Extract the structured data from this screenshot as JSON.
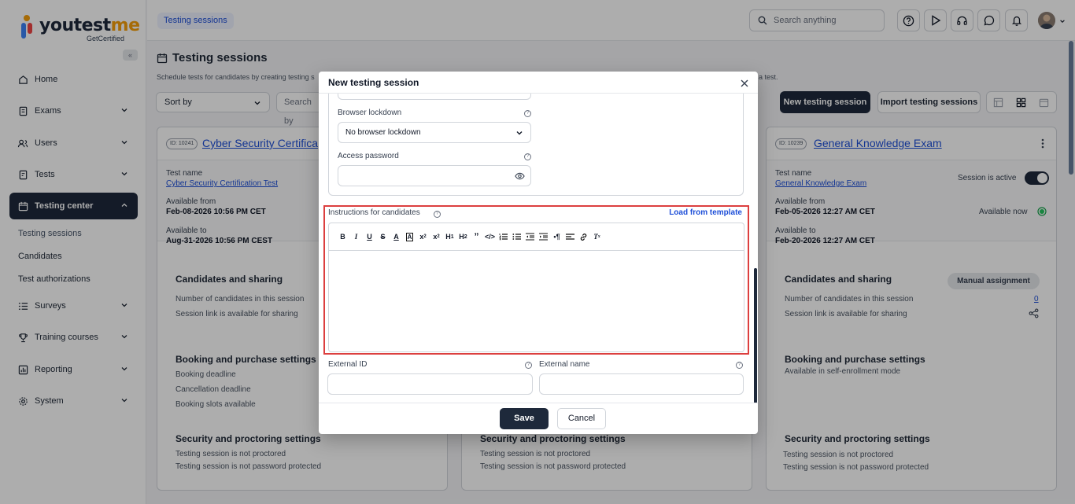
{
  "brand": {
    "name_a": "youtest",
    "name_b": "me",
    "tagline": "GetCertified"
  },
  "sidebar": {
    "items": [
      {
        "label": "Home"
      },
      {
        "label": "Exams"
      },
      {
        "label": "Users"
      },
      {
        "label": "Tests"
      },
      {
        "label": "Testing center"
      },
      {
        "label": "Surveys"
      },
      {
        "label": "Training courses"
      },
      {
        "label": "Reporting"
      },
      {
        "label": "System"
      }
    ],
    "sub_items": [
      {
        "label": "Testing sessions"
      },
      {
        "label": "Candidates"
      },
      {
        "label": "Test authorizations"
      }
    ]
  },
  "topbar": {
    "breadcrumb": "Testing sessions",
    "search_placeholder": "Search anything"
  },
  "page": {
    "title": "Testing sessions",
    "description": "Schedule tests for candidates by creating testing s",
    "description_tail": "k a test.",
    "sort_label": "Sort by",
    "search_label": "Search by",
    "new_button": "New testing session",
    "import_button": "Import testing sessions"
  },
  "cards": [
    {
      "id": "ID: 10241",
      "name": "Cyber Security Certifica",
      "test_name_label": "Test name",
      "test_name": "Cyber Security Certification Test",
      "from_label": "Available from",
      "from": "Feb-08-2026 10:56 PM CET",
      "to_label": "Available to",
      "to": "Aug-31-2026 10:56 PM CEST",
      "sharing_title": "Candidates and sharing",
      "sharing_1": "Number of candidates in this session",
      "sharing_2": "Session link is available for sharing",
      "booking_title": "Booking and purchase settings",
      "booking_1": "Booking deadline",
      "booking_2": "Cancellation deadline",
      "booking_3": "Booking slots available",
      "security_title": "Security and proctoring settings",
      "security_1": "Testing session is not proctored",
      "security_2": "Testing session is not password protected"
    },
    {
      "security_title": "Security and proctoring settings",
      "security_1": "Testing session is not proctored",
      "security_2": "Testing session is not password protected"
    },
    {
      "id": "ID: 10239",
      "name": "General Knowledge Exam",
      "test_name_label": "Test name",
      "test_name": "General Knowledge Exam",
      "active_label": "Session is active",
      "from_label": "Available from",
      "from": "Feb-05-2026 12:27 AM CET",
      "available_now": "Available now",
      "to_label": "Available to",
      "to": "Feb-20-2026 12:27 AM CET",
      "sharing_title": "Candidates and sharing",
      "assignment_badge": "Manual assignment",
      "sharing_1": "Number of candidates in this session",
      "candidates_count": "0",
      "sharing_2": "Session link is available for sharing",
      "booking_title": "Booking and purchase settings",
      "booking_1": "Available in self-enrollment mode",
      "security_title": "Security and proctoring settings",
      "security_1": "Testing session is not proctored",
      "security_2": "Testing session is not password protected"
    }
  ],
  "modal": {
    "title": "New testing session",
    "browser_lockdown_label": "Browser lockdown",
    "browser_lockdown_value": "No browser lockdown",
    "access_password_label": "Access password",
    "instructions_label": "Instructions for candidates",
    "load_template": "Load from template",
    "external_id_label": "External ID",
    "external_name_label": "External name",
    "save": "Save",
    "cancel": "Cancel"
  },
  "colors": {
    "primary": "#1e293b",
    "link": "#1d4ed8",
    "highlight": "#dc3f3f"
  }
}
